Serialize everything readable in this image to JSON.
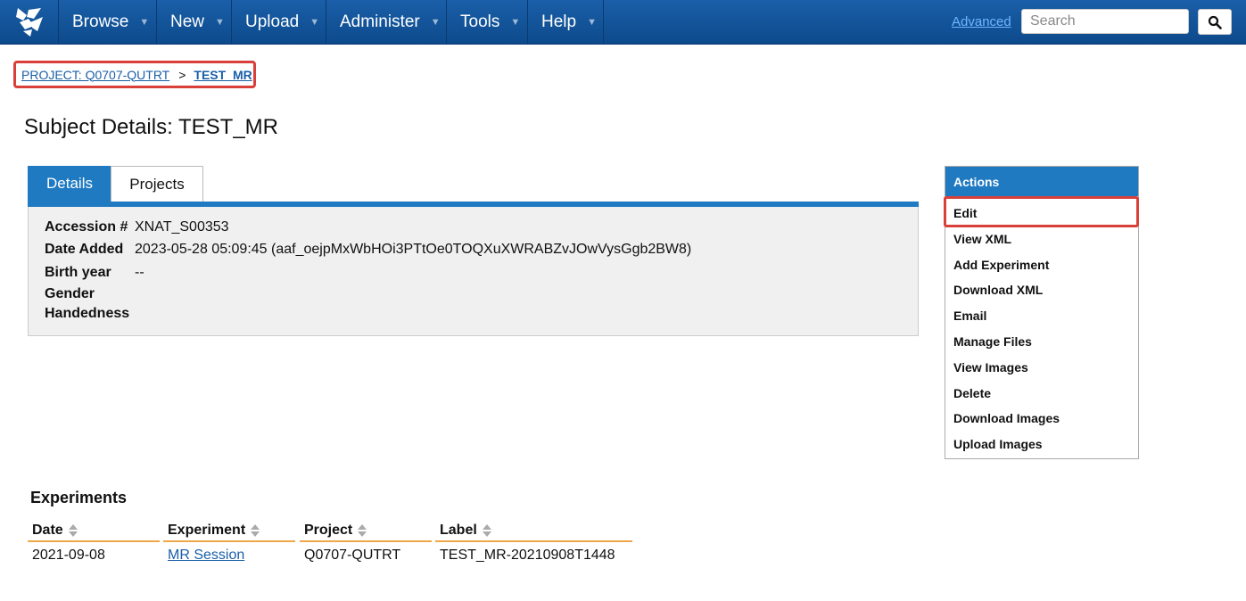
{
  "nav": {
    "items": [
      {
        "label": "Browse"
      },
      {
        "label": "New"
      },
      {
        "label": "Upload"
      },
      {
        "label": "Administer"
      },
      {
        "label": "Tools"
      },
      {
        "label": "Help"
      }
    ],
    "advanced_link": "Advanced",
    "search_placeholder": "Search",
    "brand_color": "#0d4a8c"
  },
  "breadcrumb": {
    "project": "PROJECT: Q0707-QUTRT",
    "separator": ">",
    "current": "TEST_MR"
  },
  "page_title": "Subject Details: TEST_MR",
  "tabs": [
    {
      "label": "Details",
      "active": true
    },
    {
      "label": "Projects",
      "active": false
    }
  ],
  "details": [
    {
      "key": "Accession #",
      "value": "XNAT_S00353"
    },
    {
      "key": "Date Added",
      "value": "2023-05-28 05:09:45 (aaf_oejpMxWbHOi3PTtOe0TOQXuXWRABZvJOwVysGgb2BW8)"
    },
    {
      "key": "Birth year",
      "value": "--"
    },
    {
      "key": "Gender",
      "value": ""
    },
    {
      "key": "Handedness",
      "value": ""
    }
  ],
  "actions": {
    "header": "Actions",
    "items": [
      "Edit",
      "View XML",
      "Add Experiment",
      "Download XML",
      "Email",
      "Manage Files",
      "View Images",
      "Delete",
      "Download Images",
      "Upload Images"
    ]
  },
  "experiments": {
    "title": "Experiments",
    "columns": [
      "Date",
      "Experiment",
      "Project",
      "Label"
    ],
    "rows": [
      {
        "date": "2021-09-08",
        "experiment": "MR Session",
        "project": "Q0707-QUTRT",
        "label": "TEST_MR-20210908T1448"
      }
    ]
  }
}
